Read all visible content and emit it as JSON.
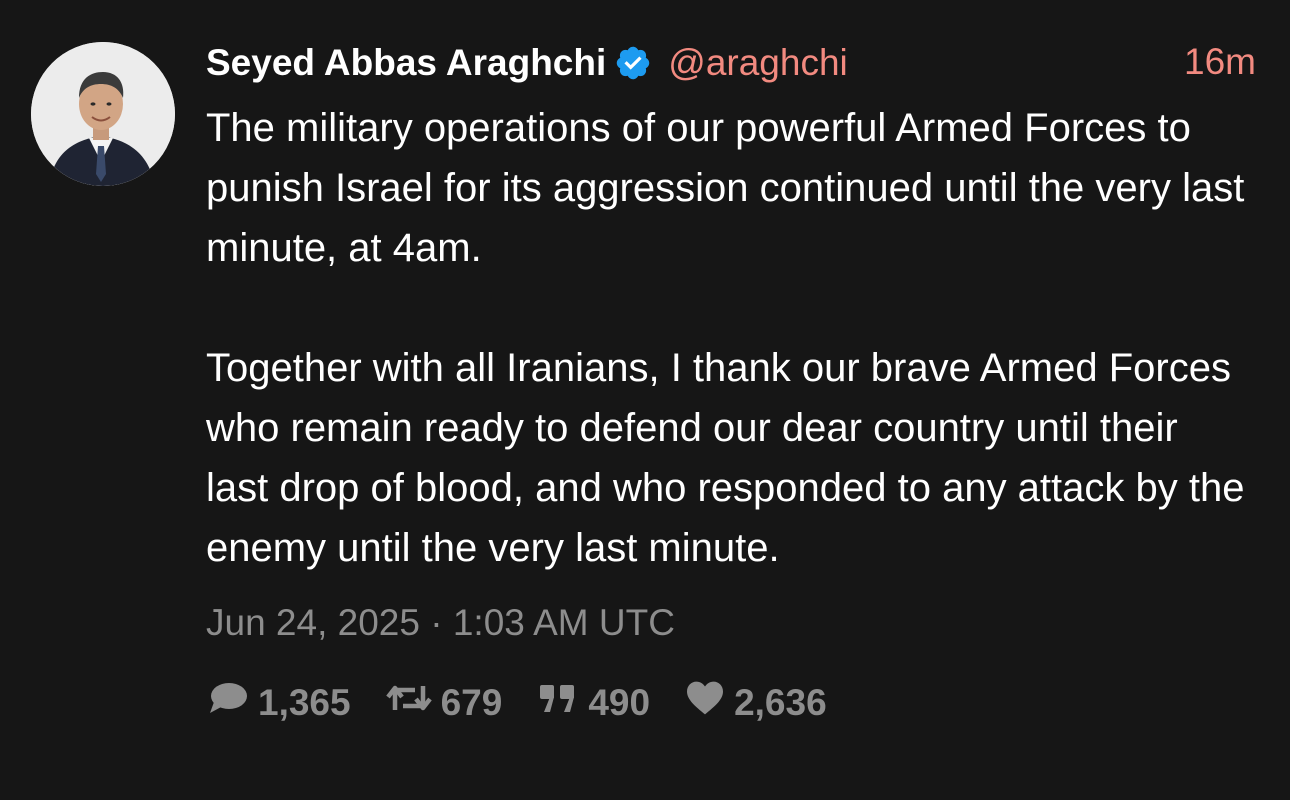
{
  "tweet": {
    "display_name": "Seyed Abbas Araghchi",
    "handle": "@araghchi",
    "time_ago": "16m",
    "body": "The military operations of our powerful Armed Forces to punish Israel for its aggression continued until the very last minute, at 4am.\n\nTogether with all Iranians, I thank our brave Armed Forces who remain ready to defend our dear country until their last drop of blood, and who responded to any attack by the enemy until the very last minute.",
    "timestamp": "Jun 24, 2025 · 1:03 AM UTC",
    "stats": {
      "replies": "1,365",
      "retweets": "679",
      "quotes": "490",
      "likes": "2,636"
    },
    "icons": {
      "verified": "verified-badge-icon",
      "replies": "comment-icon",
      "retweets": "retweet-icon",
      "quotes": "quote-icon",
      "likes": "heart-icon"
    }
  },
  "colors": {
    "background": "#161616",
    "text": "#ffffff",
    "muted": "#8d8d8d",
    "accent": "#f28a80",
    "verified": "#1d9bf0"
  }
}
